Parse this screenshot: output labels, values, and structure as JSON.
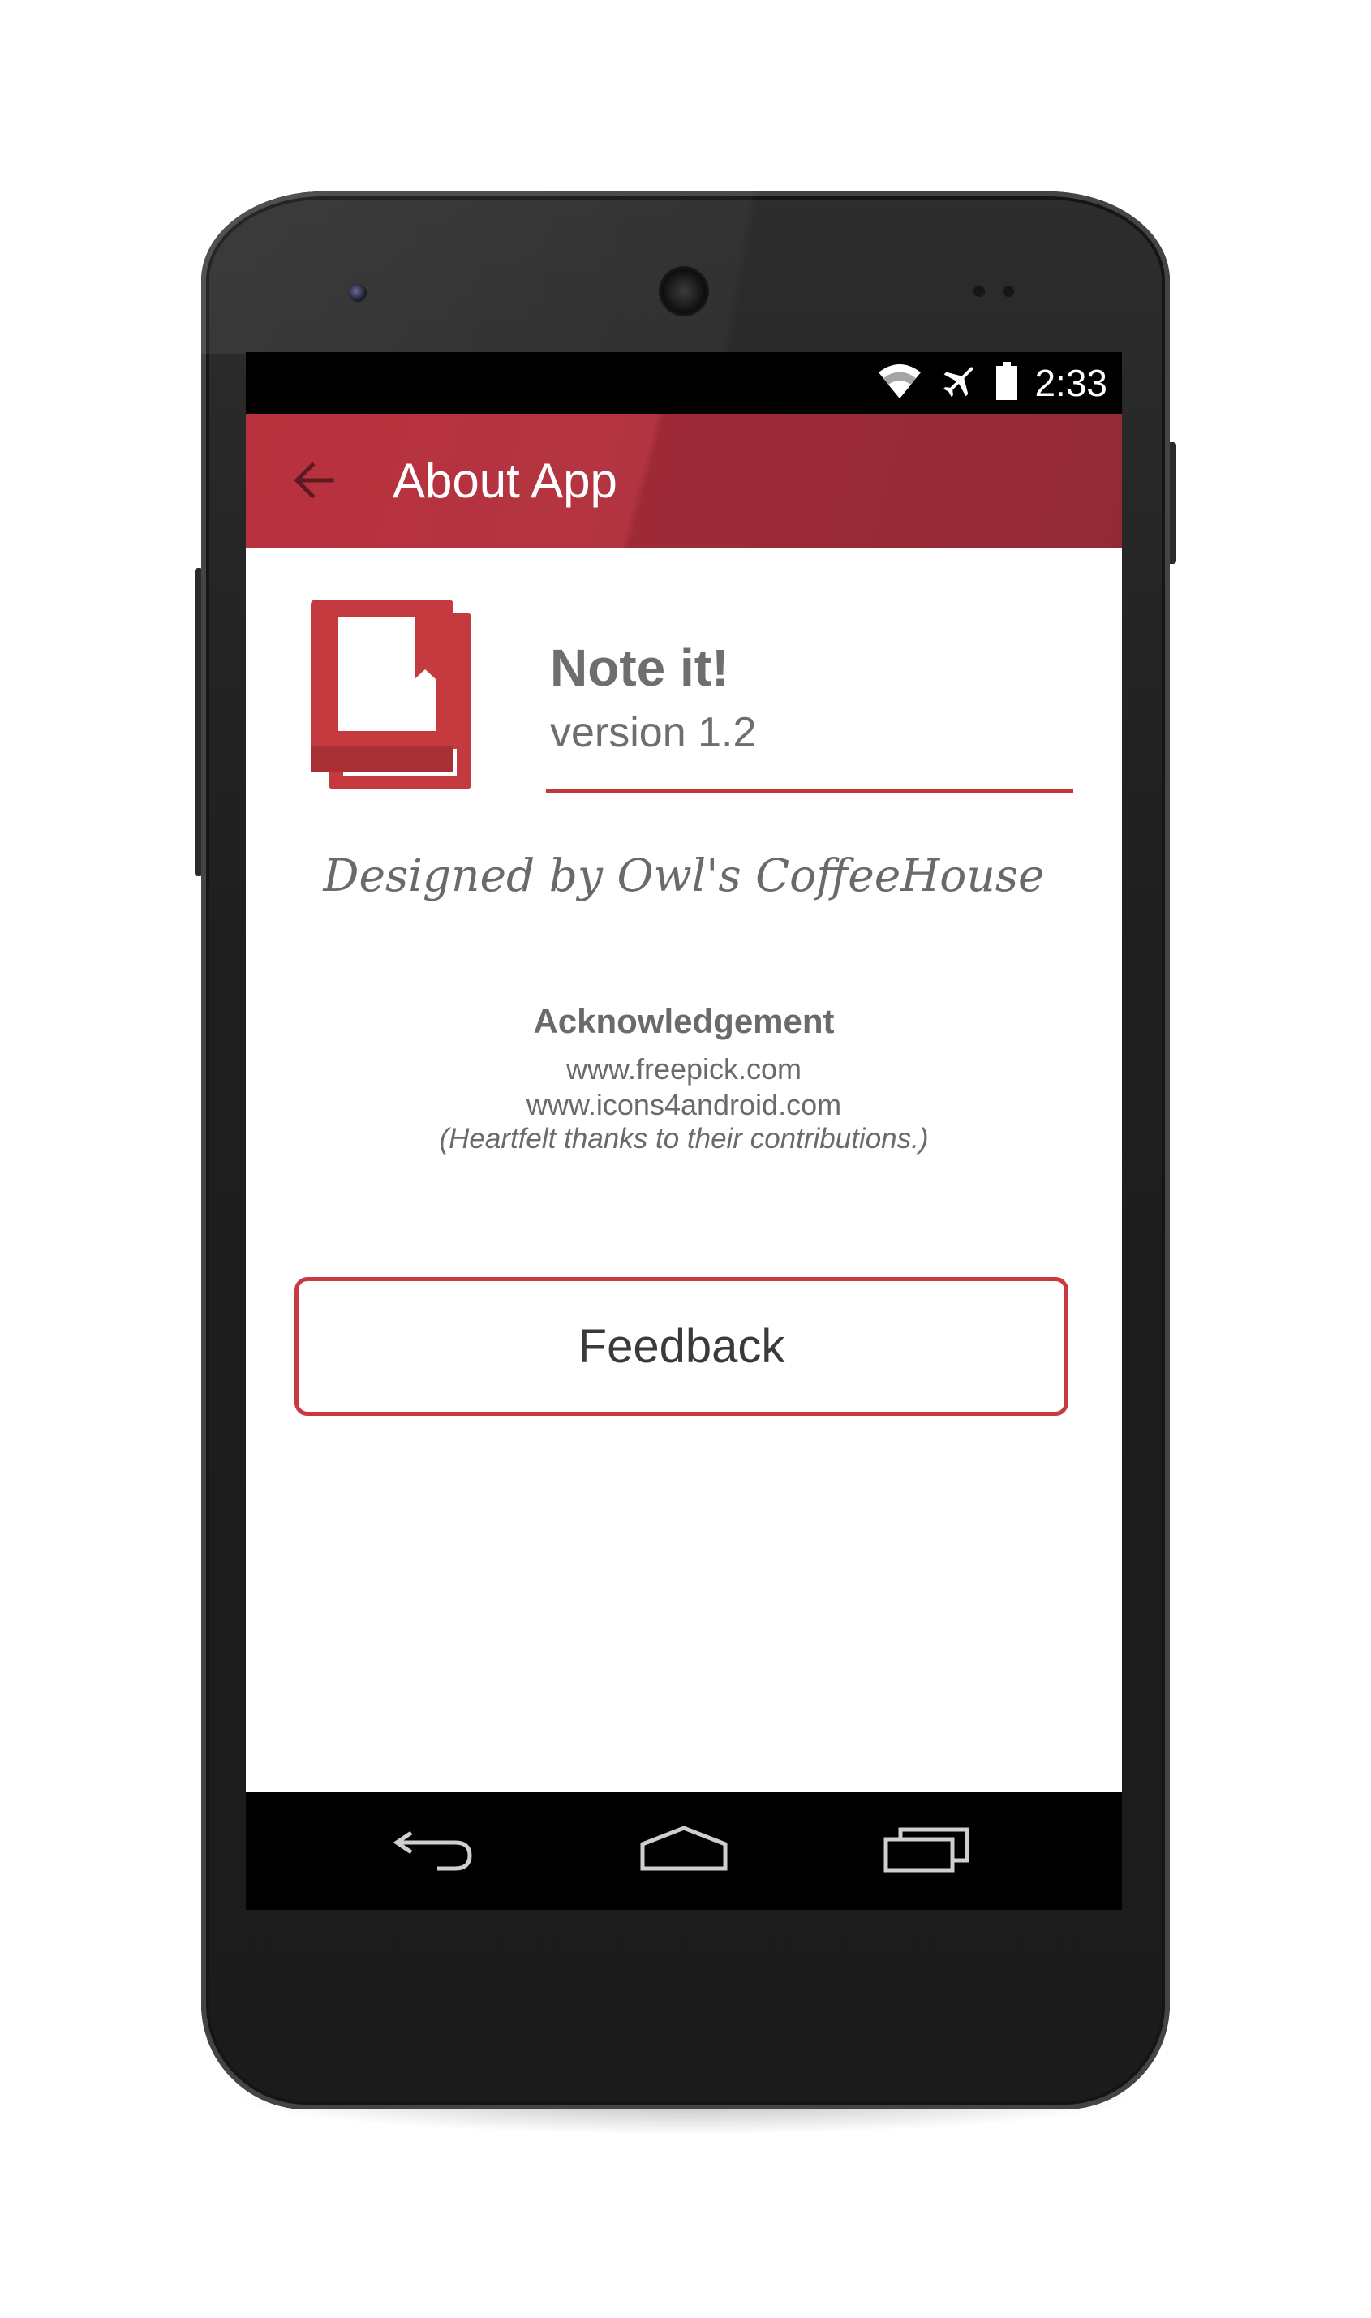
{
  "status_bar": {
    "time": "2:33",
    "icons": [
      "wifi-icon",
      "airplane-mode-icon",
      "battery-icon"
    ]
  },
  "app_bar": {
    "title": "About App",
    "back_icon": "back-arrow-icon"
  },
  "about": {
    "app_name": "Note it!",
    "version": "version 1.2",
    "designed_by": "Designed by Owl's CoffeeHouse",
    "logo_icon": "book-bookmark-icon"
  },
  "acknowledgement": {
    "heading": "Acknowledgement",
    "links": [
      "www.freepick.com",
      "www.icons4android.com"
    ],
    "note": "(Heartfelt thanks to their contributions.)"
  },
  "feedback": {
    "label": "Feedback"
  },
  "nav_bar": {
    "icons": [
      "nav-back-icon",
      "nav-home-icon",
      "nav-recents-icon"
    ]
  },
  "colors": {
    "accent": "#b8323d",
    "accent_dark": "#932937",
    "text_gray": "#6e6e6e",
    "button_border": "#c83a3f"
  }
}
